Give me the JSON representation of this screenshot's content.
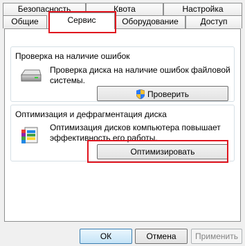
{
  "tabs_row1": [
    {
      "label": "Безопасность"
    },
    {
      "label": "Квота"
    },
    {
      "label": "Настройка"
    }
  ],
  "tabs_row2": [
    {
      "label": "Общие"
    },
    {
      "label": "Сервис",
      "active": true
    },
    {
      "label": "Оборудование"
    },
    {
      "label": "Доступ"
    }
  ],
  "error_check": {
    "title": "Проверка на наличие ошибок",
    "description": "Проверка диска на наличие ошибок файловой системы.",
    "button_label": "Проверить",
    "button_icon": "uac-shield-icon"
  },
  "optimize": {
    "title": "Оптимизация и дефрагментация диска",
    "description": "Оптимизация дисков компьютера повышает эффективность его работы.",
    "button_label": "Оптимизировать",
    "icon": "defrag-icon"
  },
  "footer": {
    "ok_label": "ОК",
    "cancel_label": "Отмена",
    "apply_label": "Применить"
  },
  "colors": {
    "highlight": "#e0141e",
    "group_border": "#d5dfe5"
  }
}
